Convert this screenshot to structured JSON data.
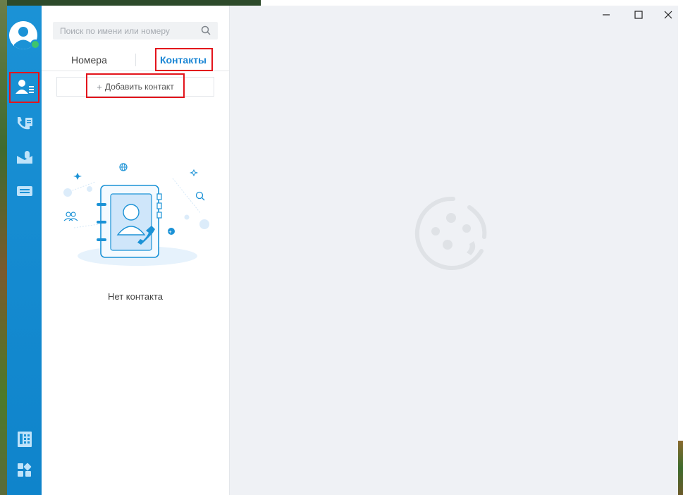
{
  "search": {
    "placeholder": "Поиск по имени или номеру"
  },
  "tabs": [
    {
      "label": "Номера",
      "active": false
    },
    {
      "label": "Контакты",
      "active": true
    }
  ],
  "add_contact": {
    "plus": "+",
    "label": "Добавить контакт"
  },
  "empty_state": {
    "text": "Нет контакта"
  },
  "sidebar": {
    "items": [
      {
        "icon": "contacts-icon",
        "active": true
      },
      {
        "icon": "call-log-icon"
      },
      {
        "icon": "voicemail-icon"
      },
      {
        "icon": "dialer-icon"
      },
      {
        "icon": "phone-book-icon"
      },
      {
        "icon": "apps-icon"
      }
    ],
    "status": "online"
  },
  "window_controls": [
    "minimize-icon",
    "maximize-icon",
    "close-icon"
  ],
  "colors": {
    "sidebar": "#1b92d6",
    "accent": "#1b86d4",
    "highlight": "#e3141c",
    "status": "#3ec46d",
    "main_bg": "#eff1f5"
  }
}
